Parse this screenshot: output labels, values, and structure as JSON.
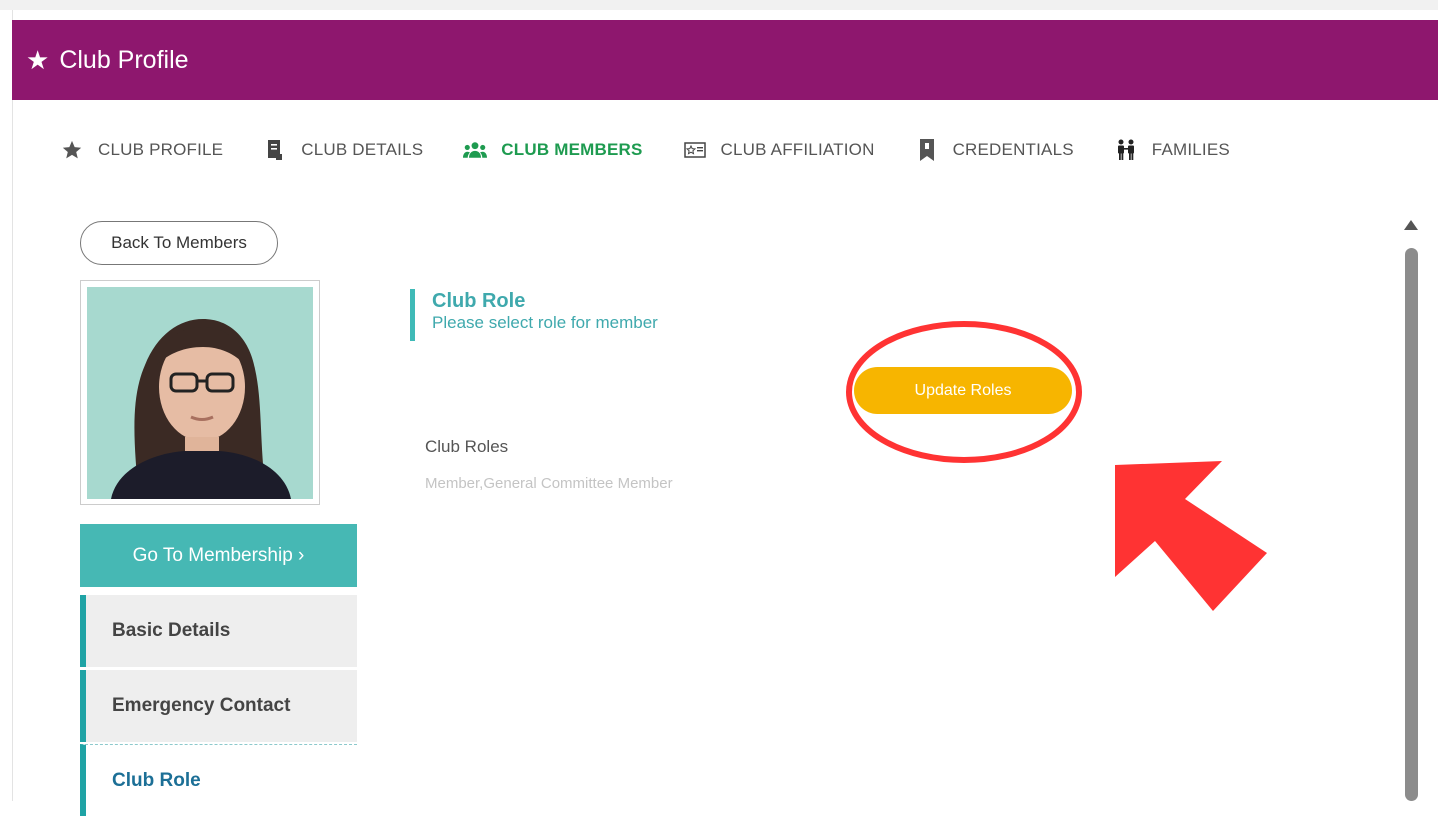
{
  "header": {
    "title": "Club Profile",
    "icon": "star-icon"
  },
  "tabs": [
    {
      "label": "CLUB PROFILE",
      "icon": "star-icon",
      "active": false
    },
    {
      "label": "CLUB DETAILS",
      "icon": "document-icon",
      "active": false
    },
    {
      "label": "CLUB MEMBERS",
      "icon": "members-icon",
      "active": true
    },
    {
      "label": "CLUB AFFILIATION",
      "icon": "id-card-icon",
      "active": false
    },
    {
      "label": "CREDENTIALS",
      "icon": "bookmark-icon",
      "active": false
    },
    {
      "label": "FAMILIES",
      "icon": "family-icon",
      "active": false
    }
  ],
  "back_button": "Back To Members",
  "sidebar": {
    "go_membership": "Go To Membership ›",
    "items": [
      {
        "label": "Basic Details",
        "active": false
      },
      {
        "label": "Emergency Contact",
        "active": false
      },
      {
        "label": "Club Role",
        "active": true
      }
    ]
  },
  "section": {
    "title": "Club Role",
    "subtitle": "Please select role for member"
  },
  "update_button": "Update Roles",
  "roles": {
    "label": "Club Roles",
    "value": "Member,General Committee Member"
  },
  "colors": {
    "header": "#8e176e",
    "accent_teal": "#46b8b4",
    "active_tab": "#1e9b50",
    "button_yellow": "#f7b500",
    "annotation_red": "#ff3333"
  }
}
